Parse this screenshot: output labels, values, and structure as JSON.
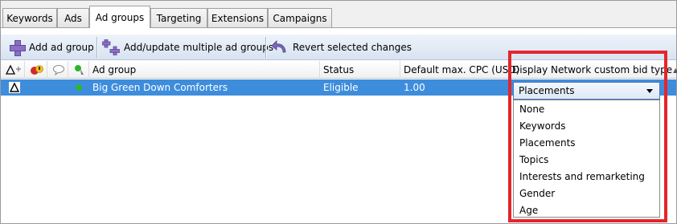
{
  "tabs": [
    {
      "label": "Keywords",
      "active": false
    },
    {
      "label": "Ads",
      "active": false
    },
    {
      "label": "Ad groups",
      "active": true
    },
    {
      "label": "Targeting",
      "active": false
    },
    {
      "label": "Extensions",
      "active": false
    },
    {
      "label": "Campaigns",
      "active": false
    }
  ],
  "toolbar": {
    "add_label": "Add ad group",
    "add_multiple_label": "Add/update multiple ad groups",
    "revert_label": "Revert selected changes"
  },
  "grid": {
    "columns": {
      "ad_group": "Ad group",
      "status": "Status",
      "default_cpc": "Default max. CPC (USD)",
      "display_bid": "Display Network custom bid type"
    },
    "rows": [
      {
        "ad_group": "Big Green Down Comforters",
        "status": "Eligible",
        "default_cpc": "1.00"
      }
    ]
  },
  "dropdown": {
    "selected": "Placements",
    "options": [
      "None",
      "Keywords",
      "Placements",
      "Topics",
      "Interests and remarketing",
      "Gender",
      "Age"
    ]
  },
  "colors": {
    "selection": "#3e8ddd",
    "highlight_border": "#e3262b",
    "status_dot": "#2db52d"
  }
}
